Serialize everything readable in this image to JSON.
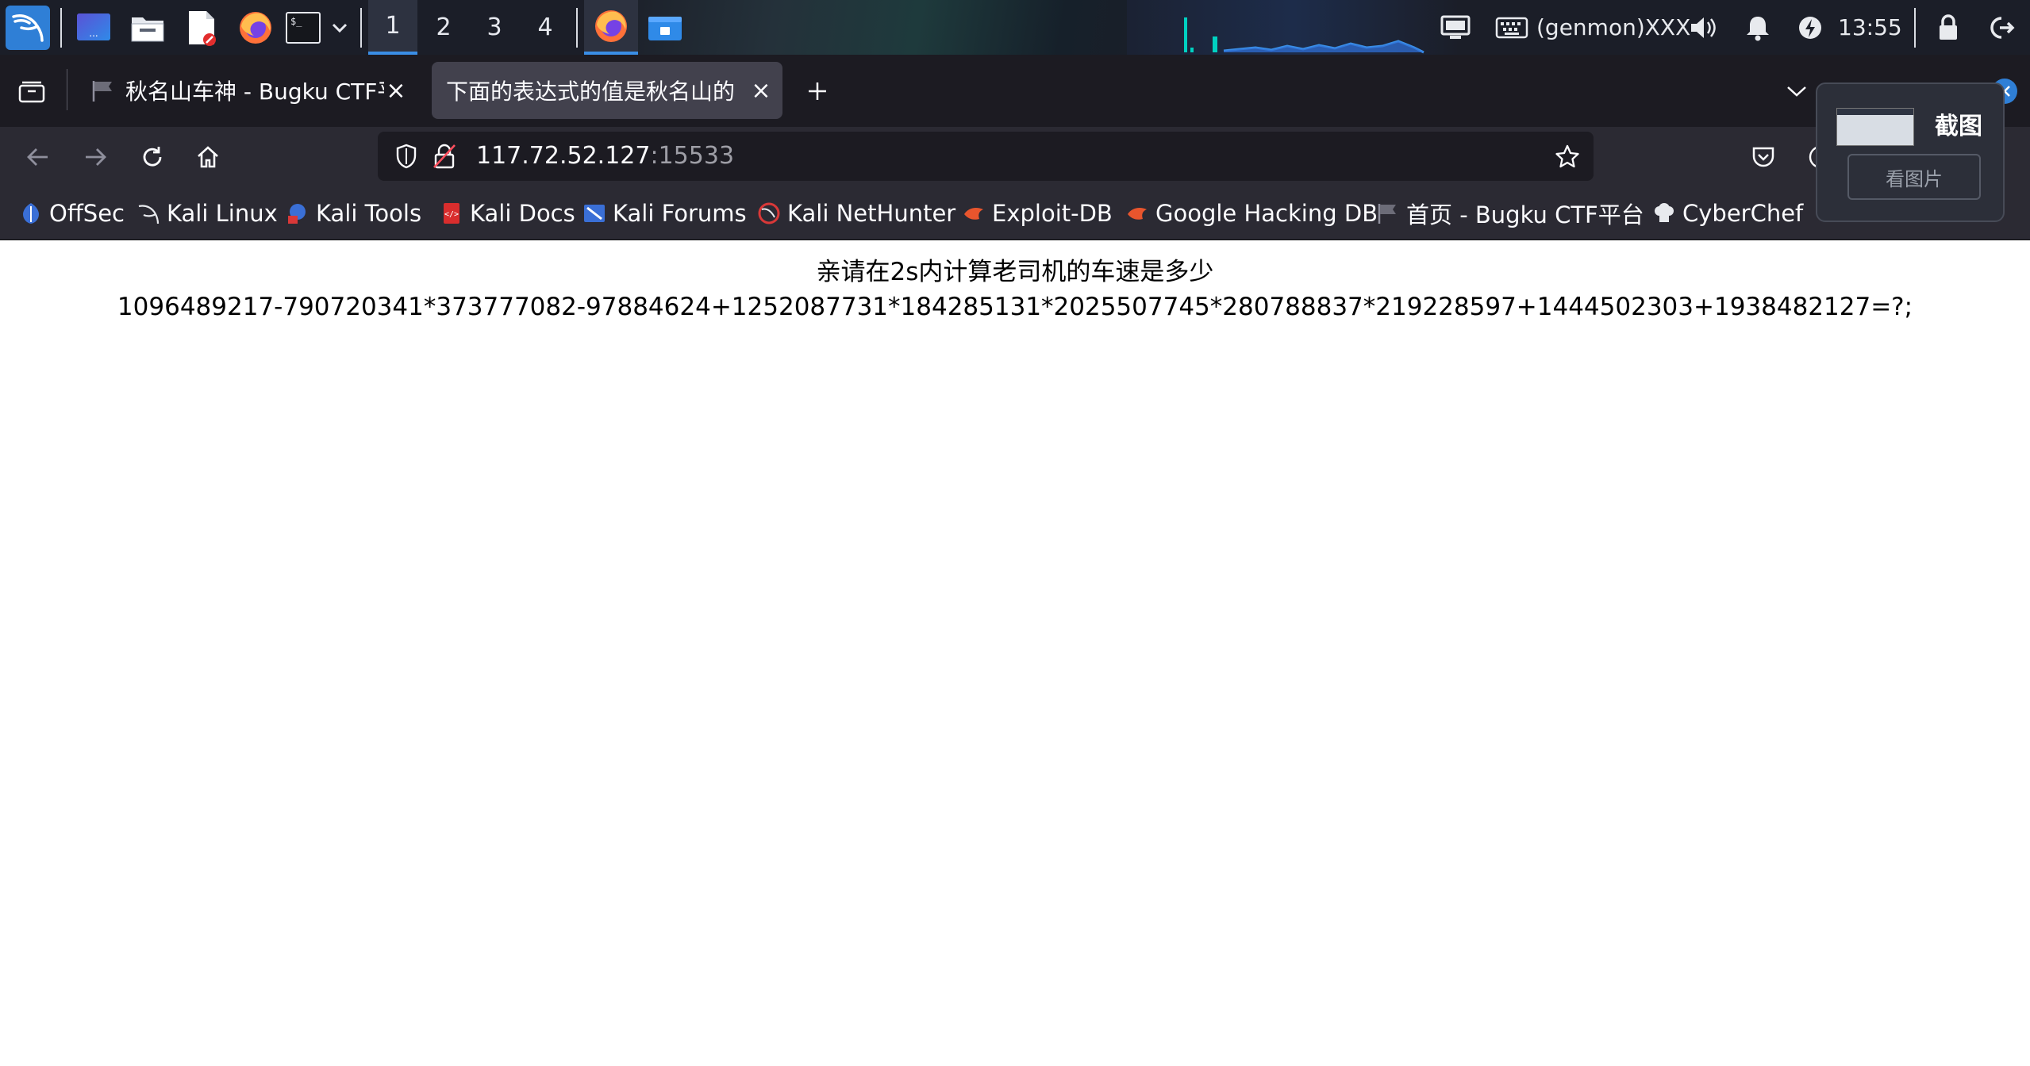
{
  "panel": {
    "workspaces": [
      "1",
      "2",
      "3",
      "4"
    ],
    "active_workspace": "1",
    "genmon_label": "(genmon)XXX",
    "clock": "13:55",
    "icons": [
      "kali-menu-icon",
      "desktop-icon",
      "file-manager-icon",
      "text-editor-icon",
      "firefox-icon",
      "terminal-icon",
      "chevron-down-icon",
      "lock-icon",
      "logout-icon"
    ]
  },
  "tabs": [
    {
      "title": "秋名山车神 - Bugku CTF平台",
      "active": false
    },
    {
      "title": "下面的表达式的值是秋名山的",
      "active": true
    }
  ],
  "address_bar": {
    "host": "117.72.52.127",
    "port": ":15533"
  },
  "bookmarks": [
    {
      "label": "OffSec"
    },
    {
      "label": "Kali Linux"
    },
    {
      "label": "Kali Tools"
    },
    {
      "label": "Kali Docs"
    },
    {
      "label": "Kali Forums"
    },
    {
      "label": "Kali NetHunter"
    },
    {
      "label": "Exploit-DB"
    },
    {
      "label": "Google Hacking DB"
    },
    {
      "label": "首页 - Bugku CTF平台"
    },
    {
      "label": "CyberChef"
    }
  ],
  "page": {
    "line1": "亲请在2s内计算老司机的车速是多少",
    "line2": "1096489217-790720341*373777082-97884624+1252087731*184285131*2025507745*280788837*219228597+1444502303+1938482127=?;"
  },
  "screenshot_popup": {
    "title": "截图",
    "button": "看图片"
  },
  "colors": {
    "panel_bg": "#1b1e28",
    "tab_bar_bg": "#1c1b22",
    "toolbar_bg": "#2b2a33",
    "active_tab_bg": "#42414d",
    "workspace_accent": "#3a8ee6",
    "graph_accent": "#00d1c1"
  }
}
